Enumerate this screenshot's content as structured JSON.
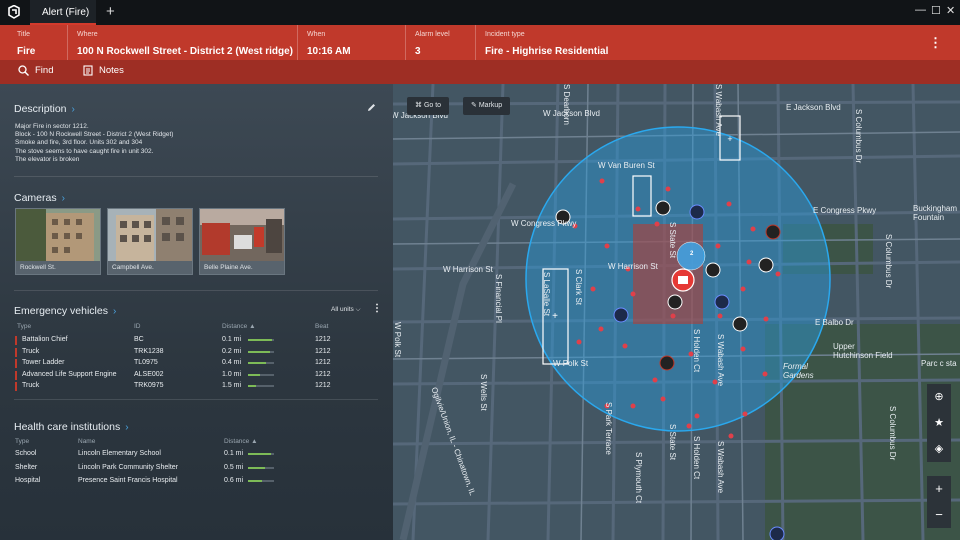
{
  "titlebar": {
    "tab_label": "Alert (Fire)",
    "add_tab": "+",
    "min": "—",
    "max": "☐",
    "close": "✕"
  },
  "alert": {
    "title": {
      "label": "Title",
      "value": "Fire"
    },
    "where": {
      "label": "Where",
      "value": "100 N Rockwell Street - District 2 (West ridge)"
    },
    "when": {
      "label": "When",
      "value": "10:16 AM"
    },
    "alarm": {
      "label": "Alarm level",
      "value": "3"
    },
    "incident": {
      "label": "Incident type",
      "value": "Fire - Highrise Residential"
    },
    "menu": "⋮"
  },
  "toolbar": {
    "find": "Find",
    "notes": "Notes"
  },
  "description": {
    "title": "Description",
    "lines": [
      "Major Fire in sector 1212.",
      "Block - 100 N Rockwell Street - District 2 (West Ridget)",
      "Smoke and fire, 3rd floor. Units 302 and 304",
      "The stove seems to have caught fire in unit 302.",
      "The elevator is broken"
    ]
  },
  "cameras": {
    "title": "Cameras",
    "items": [
      {
        "label": "Rockwell St."
      },
      {
        "label": "Campbell Ave."
      },
      {
        "label": "Belle Plaine Ave."
      }
    ]
  },
  "vehicles": {
    "title": "Emergency vehicles",
    "filter": "All units ⌵",
    "headers": {
      "type": "Type",
      "id": "ID",
      "distance": "Distance ▲",
      "beat": "Beat"
    },
    "rows": [
      {
        "type": "Battalion Chief",
        "id": "BC",
        "distance": "0.1 mi",
        "beat": "1212",
        "fill": 0.92
      },
      {
        "type": "Truck",
        "id": "TRK1238",
        "distance": "0.2 mi",
        "beat": "1212",
        "fill": 0.85
      },
      {
        "type": "Tower Ladder",
        "id": "TL0975",
        "distance": "0.4 mi",
        "beat": "1212",
        "fill": 0.7
      },
      {
        "type": "Advanced Life Support Engine",
        "id": "ALSE002",
        "distance": "1.0 mi",
        "beat": "1212",
        "fill": 0.45
      },
      {
        "type": "Truck",
        "id": "TRK0975",
        "distance": "1.5 mi",
        "beat": "1212",
        "fill": 0.3
      }
    ]
  },
  "health": {
    "title": "Health care institutions",
    "headers": {
      "type": "Type",
      "name": "Name",
      "distance": "Distance ▲"
    },
    "rows": [
      {
        "type": "School",
        "name": "Lincoln Elementary School",
        "distance": "0.1 mi",
        "fill": 0.9
      },
      {
        "type": "Shelter",
        "name": "Lincoln Park Community Shelter",
        "distance": "0.5 mi",
        "fill": 0.65
      },
      {
        "type": "Hospital",
        "name": "Presence Saint Francis Hospital",
        "distance": "0.6 mi",
        "fill": 0.55
      }
    ]
  },
  "map": {
    "goto": "Go to",
    "markup": "Markup",
    "labels": {
      "w_jackson_blvd": "W Jackson Blvd",
      "w_jackson_blvd2": "W Jackson Blvd",
      "e_jackson_blvd": "E Jackson Blvd",
      "w_van_buren": "W Van Buren St",
      "w_congress": "W Congress Pkwy",
      "e_congress": "E Congress Pkwy",
      "w_harrison": "W Harrison St",
      "w_harrison2": "W Harrison St",
      "e_balbo": "E Balbo Dr",
      "w_polk": "W Polk St",
      "w_polk2": "W Polk St",
      "buckingham": "Buckingham Fountain",
      "upper_hutchinson": "Upper Hutchinson Field",
      "formal_gardens": "Formal Gardens",
      "parc": "Parc c sta",
      "s_financial": "S Financial Pl",
      "s_lasalle": "S LaSalle St",
      "s_clark": "S Clark St",
      "s_state": "S State St",
      "s_state2": "S State St",
      "s_holden": "S Holden Ct",
      "s_holden2": "S Holden Ct",
      "s_wabash": "S Wabash Ave",
      "s_wabash2": "S Wabash Ave",
      "s_wabash3": "S Wabash Ave",
      "s_columbus": "S Columbus Dr",
      "s_columbus2": "S Columbus Dr",
      "s_columbus3": "S Columbus Dr",
      "s_wells": "S Wells St",
      "s_plymouth": "S Plymouth Ct",
      "s_park": "S Park Terrace",
      "ogilvie": "Ogilvie/Union, IL - Chinatown, IL",
      "w_polk_side": "W Polk St",
      "s_dearborn": "S Dearborn"
    },
    "zone_count": "2",
    "zoom_in": "+",
    "zoom_out": "−"
  },
  "colors": {
    "accent": "#c0392b",
    "radius": "#2aa3e6",
    "ok": "#7dbb57"
  }
}
